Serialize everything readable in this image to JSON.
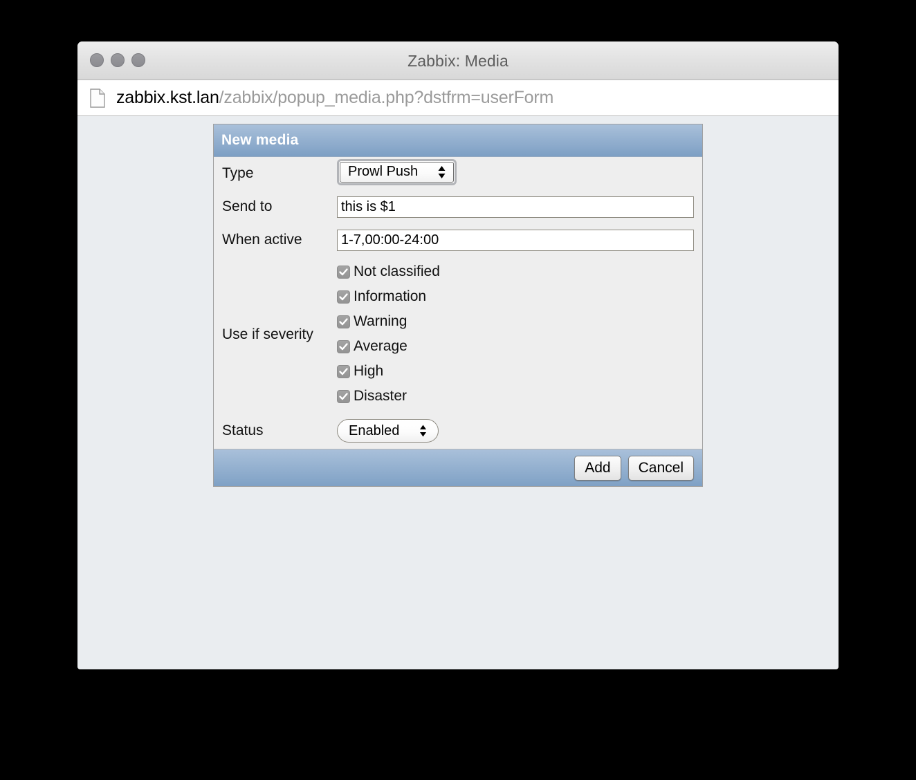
{
  "window": {
    "title": "Zabbix: Media",
    "traffic_lights": [
      "close",
      "minimize",
      "zoom"
    ]
  },
  "url_bar": {
    "icon": "document-icon",
    "host": "zabbix.kst.lan",
    "path": "/zabbix/popup_media.php?dstfrm=userForm"
  },
  "form": {
    "header_title": "New media",
    "rows": {
      "type": {
        "label": "Type",
        "value": "Prowl Push",
        "focused": true
      },
      "send_to": {
        "label": "Send to",
        "value": "this is $1",
        "placeholder": ""
      },
      "when_active": {
        "label": "When active",
        "value": "1-7,00:00-24:00",
        "placeholder": ""
      },
      "severity": {
        "label": "Use if severity",
        "options": [
          {
            "label": "Not classified",
            "checked": true
          },
          {
            "label": "Information",
            "checked": true
          },
          {
            "label": "Warning",
            "checked": true
          },
          {
            "label": "Average",
            "checked": true
          },
          {
            "label": "High",
            "checked": true
          },
          {
            "label": "Disaster",
            "checked": true
          }
        ]
      },
      "status": {
        "label": "Status",
        "value": "Enabled"
      }
    },
    "footer": {
      "add_label": "Add",
      "cancel_label": "Cancel"
    }
  },
  "colors": {
    "header_gradient_top": "#a9c0da",
    "header_gradient_bottom": "#7d9fc4",
    "form_body": "#eeeeee",
    "page_background": "#eaedf0",
    "checkbox_fill": "#9a9a9a",
    "title_text": "#5d5d5d"
  }
}
